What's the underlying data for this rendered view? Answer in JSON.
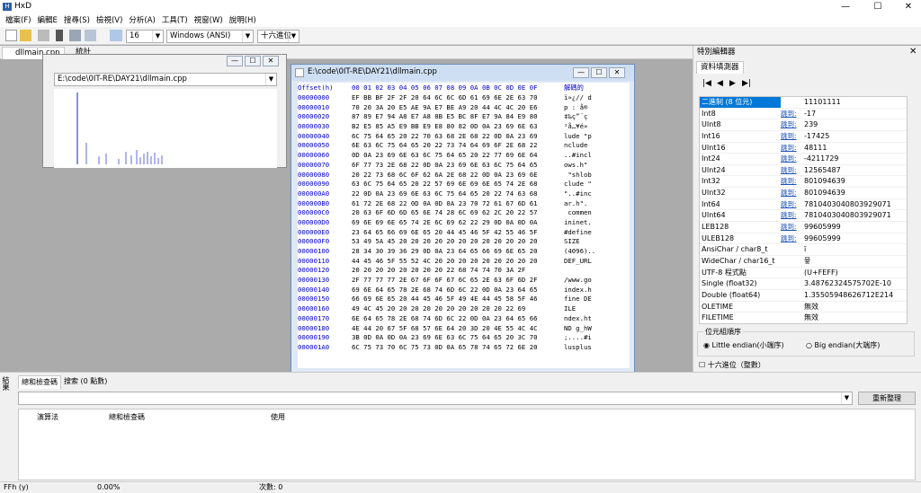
{
  "title": "HxD",
  "menu": [
    "檔案(F)",
    "編輯E",
    "搜尋(S)",
    "檢視(V)",
    "分析(A)",
    "工具(T)",
    "視窗(W)",
    "說明(H)"
  ],
  "toolbar": {
    "bytes_per_row": "16",
    "charset": "Windows (ANSI)",
    "base": "十六進位"
  },
  "tabs": [
    "dllmain.cpp",
    "統計"
  ],
  "stats_window": {
    "path": "E:\\code\\0IT-RE\\DAY21\\dllmain.cpp"
  },
  "hex_window": {
    "title": "E:\\code\\0IT-RE\\DAY21\\dllmain.cpp",
    "offset_header": "Offset(h)",
    "columns": "00 01 02 03 04 05 06 07 08 09 0A 0B 0C 0D 0E 0F",
    "decoded_header": "解碼的",
    "rows": [
      {
        "o": "00000000",
        "b": "EF BB BF 2F 2F 20 64 6C 6C 6D 61 69 6E 2E 63 70",
        "t": "ï»¿// d"
      },
      {
        "o": "00000010",
        "b": "70 20 3A 20 E5 AE 9A E7 BE A9 20 44 4C 4C 20 E6",
        "t": "p : å®"
      },
      {
        "o": "00000020",
        "b": "87 89 E7 94 A8 E7 A8 8B E5 BC 8F E7 9A 84 E9 80",
        "t": "‡‰ç”¨ç"
      },
      {
        "o": "00000030",
        "b": "B2 E5 85 A5 E9 BB E9 E8 80 82 0D 0A 23 69 6E 63",
        "t": "²å…¥é»"
      },
      {
        "o": "00000040",
        "b": "6C 75 64 65 20 22 70 63 68 2E 68 22 0D 0A 23 69",
        "t": "lude \"p"
      },
      {
        "o": "00000050",
        "b": "6E 63 6C 75 64 65 20 22 73 74 64 69 6F 2E 68 22",
        "t": "nclude "
      },
      {
        "o": "00000060",
        "b": "0D 0A 23 69 6E 63 6C 75 64 65 20 22 77 69 6E 64",
        "t": "..#incl"
      },
      {
        "o": "00000070",
        "b": "6F 77 73 2E 68 22 0D 0A 23 69 6E 63 6C 75 64 65",
        "t": "ows.h\""
      },
      {
        "o": "00000080",
        "b": "20 22 73 68 6C 6F 62 6A 2E 68 22 0D 0A 23 69 6E",
        "t": " \"shlob"
      },
      {
        "o": "00000090",
        "b": "63 6C 75 64 65 20 22 57 69 6E 69 6E 65 74 2E 68",
        "t": "clude \""
      },
      {
        "o": "000000A0",
        "b": "22 0D 0A 23 69 6E 63 6C 75 64 65 20 22 74 63 68",
        "t": "\"..#inc"
      },
      {
        "o": "000000B0",
        "b": "61 72 2E 68 22 0D 0A 0D 0A 23 70 72 61 67 6D 61",
        "t": "ar.h\"."
      },
      {
        "o": "000000C0",
        "b": "20 63 6F 6D 6D 65 6E 74 28 6C 69 62 2C 20 22 57",
        "t": " commen"
      },
      {
        "o": "000000D0",
        "b": "69 6E 69 6E 65 74 2E 6C 69 62 22 29 0D 0A 0D 0A",
        "t": "ininet."
      },
      {
        "o": "000000E0",
        "b": "23 64 65 66 69 6E 65 20 44 45 46 5F 42 55 46 5F",
        "t": "#define"
      },
      {
        "o": "000000F0",
        "b": "53 49 5A 45 20 20 20 20 20 20 20 20 20 20 20 20",
        "t": "SIZE   "
      },
      {
        "o": "00000100",
        "b": "28 34 30 39 36 29 0D 0A 23 64 65 66 69 6E 65 20",
        "t": "(4096).."
      },
      {
        "o": "00000110",
        "b": "44 45 46 5F 55 52 4C 20 20 20 20 20 20 20 20 20",
        "t": "DEF_URL"
      },
      {
        "o": "00000120",
        "b": "20 20 20 20 20 20 20 20 22 68 74 74 70 3A 2F",
        "t": "       "
      },
      {
        "o": "00000130",
        "b": "2F 77 77 77 2E 67 6F 6F 67 6C 65 2E 63 6F 6D 2F",
        "t": "/www.go"
      },
      {
        "o": "00000140",
        "b": "69 6E 64 65 78 2E 68 74 6D 6C 22 0D 0A 23 64 65",
        "t": "index.h"
      },
      {
        "o": "00000150",
        "b": "66 69 6E 65 20 44 45 46 5F 49 4E 44 45 58 5F 46",
        "t": "fine DE"
      },
      {
        "o": "00000160",
        "b": "49 4C 45 20 20 20 20 20 20 20 20 20 20 22 69",
        "t": "ILE    "
      },
      {
        "o": "00000170",
        "b": "6E 64 65 78 2E 68 74 6D 6C 22 0D 0A 23 64 65 66",
        "t": "ndex.ht"
      },
      {
        "o": "00000180",
        "b": "4E 44 20 67 5F 68 57 6E 64 20 3D 20 4E 55 4C 4C",
        "t": "ND g_hW"
      },
      {
        "o": "00000190",
        "b": "3B 0D 0A 0D 0A 23 69 6E 63 6C 75 64 65 20 3C 70",
        "t": ";....#i"
      },
      {
        "o": "000001A0",
        "b": "6C 75 73 70 6C 75 73 0D 0A 65 78 74 65 72 6E 20",
        "t": "lusplus"
      }
    ]
  },
  "inspector": {
    "panel_title": "特別編輯器",
    "tab": "資料填測器",
    "jump": "跳到:",
    "rows": [
      {
        "n": "二進制 (8 位元)",
        "v": "11101111",
        "sel": true
      },
      {
        "n": "Int8",
        "v": "-17"
      },
      {
        "n": "UInt8",
        "v": "239"
      },
      {
        "n": "Int16",
        "v": "-17425"
      },
      {
        "n": "UInt16",
        "v": "48111"
      },
      {
        "n": "Int24",
        "v": "-4211729"
      },
      {
        "n": "UInt24",
        "v": "12565487"
      },
      {
        "n": "Int32",
        "v": "801094639"
      },
      {
        "n": "UInt32",
        "v": "801094639"
      },
      {
        "n": "Int64",
        "v": "7810403040803929071"
      },
      {
        "n": "UInt64",
        "v": "7810403040803929071"
      },
      {
        "n": "LEB128",
        "v": "99605999"
      },
      {
        "n": "ULEB128",
        "v": "99605999"
      },
      {
        "n": "AnsiChar / char8_t",
        "v": "ï"
      },
      {
        "n": "WideChar / char16_t",
        "v": "뮿"
      },
      {
        "n": "UTF-8 程式點",
        "v": "(U+FEFF)"
      },
      {
        "n": "Single (float32)",
        "v": "3.48762324575702E-10"
      },
      {
        "n": "Double (float64)",
        "v": "1.35505948626712E214"
      },
      {
        "n": "OLETIME",
        "v": "無效"
      },
      {
        "n": "FILETIME",
        "v": "無效"
      }
    ],
    "byte_order_label": "位元組順序",
    "little_endian": "Little endian(小端序)",
    "big_endian": "Big endian(大端序)",
    "hex_check": "十六進位（整數）"
  },
  "bottom": {
    "side_label": "結果",
    "tabs": [
      "總和檢查碼",
      "搜索 (0 點數)"
    ],
    "recalc": "重新整理",
    "cols": [
      "演算法",
      "總和檢查碼",
      "使用"
    ]
  },
  "status": {
    "mode": "FFh (y)",
    "percent": "0.00%",
    "count": "次數: 0"
  }
}
